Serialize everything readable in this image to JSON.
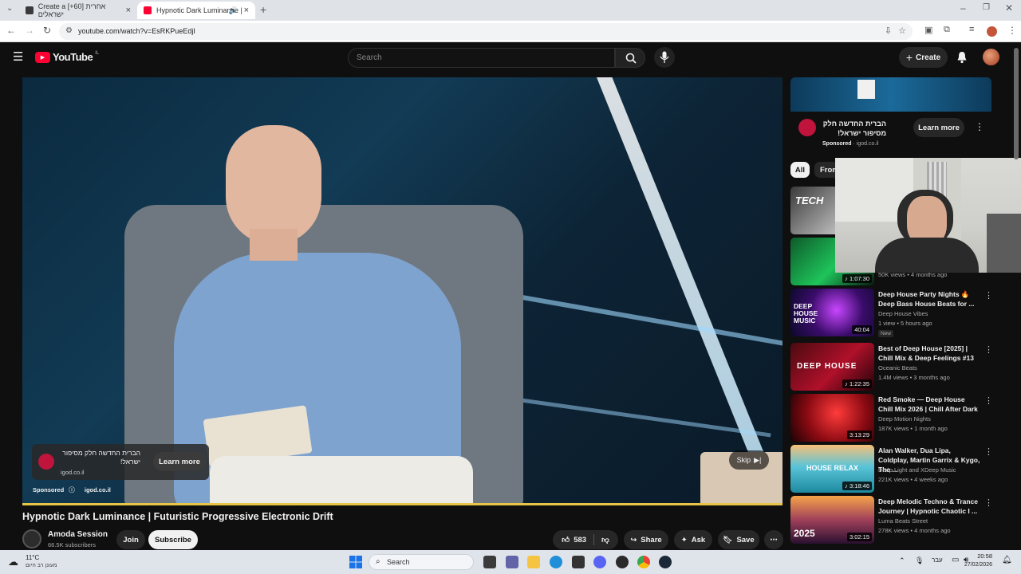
{
  "browser": {
    "tabs": [
      {
        "label": "Create a [+60] אחרית ישראלים"
      },
      {
        "label": "Hypnotic Dark Luminance | "
      }
    ],
    "url": "youtube.com/watch?v=EsRKPueEdjI"
  },
  "yt": {
    "logo": "YouTube",
    "country": "IL",
    "search_placeholder": "Search",
    "create_label": "Create"
  },
  "video_ad": {
    "text": "הברית החדשה חלק מסיפור ישראל!",
    "domain": "igod.co.il",
    "learn_more": "Learn more",
    "sponsored": "Sponsored",
    "sponsored_domain": "igod.co.il",
    "skip": "Skip"
  },
  "video": {
    "title": "Hypnotic Dark Luminance | Futuristic Progressive Electronic Drift",
    "channel": "Amoda Session",
    "subscribers": "66.5K subscribers",
    "join": "Join",
    "subscribe": "Subscribe",
    "likes": "583",
    "share": "Share",
    "ask": "Ask",
    "save": "Save"
  },
  "side_ad": {
    "text": "הברית החדשה חלק מסיפור ישראל!",
    "sponsored": "Sponsored",
    "domain": "igod.co.il",
    "learn_more": "Learn more"
  },
  "chips": [
    "All",
    "From"
  ],
  "partial_videos": [
    {
      "duration": "",
      "meta": ""
    },
    {
      "duration": "1:07:30",
      "meta": "50K views • 4 months ago"
    }
  ],
  "videos": [
    {
      "title": "Deep House Party Nights 🔥 Deep Bass House Beats for ...",
      "channel": "Deep House Vibes",
      "meta": "1 view • 5 hours ago",
      "badge": "New",
      "duration": "40:04"
    },
    {
      "title": "Best of Deep House [2025] | Chill Mix & Deep Feelings #13",
      "channel": "Oceanic Beats",
      "meta": "1.4M views • 3 months ago",
      "duration": "1:22:35"
    },
    {
      "title": "Red Smoke — Deep House Chill Mix 2026 | Chill After Dark",
      "channel": "Deep Motion Nights",
      "meta": "187K views • 1 month ago",
      "duration": "3:13:29"
    },
    {
      "title": "Alan Walker, Dua Lipa, Coldplay, Martin Garrix & Kygo, The ...",
      "channel": "Deep Light and XDeep Music",
      "meta": "221K views • 4 weeks ago",
      "duration": "3:18:46"
    },
    {
      "title": "Deep Melodic Techno & Trance Journey | Hypnotic Chaotic I ...",
      "channel": "Luma Beats Street",
      "meta": "278K views • 4 months ago",
      "duration": "3:02:15"
    }
  ],
  "thumb_texts": {
    "tech": "TECH",
    "deep_house": "DEEP HOUSE MUSIC",
    "deep_house2": "DEEP HOUSE",
    "house_relax": "HOUSE RELAX",
    "year": "2025"
  },
  "taskbar": {
    "weather_temp": "11°C",
    "weather_desc": "מעונן רב היום",
    "search": "Search",
    "lang": "עבר",
    "time": "20:58",
    "date": "27/02/2026"
  }
}
